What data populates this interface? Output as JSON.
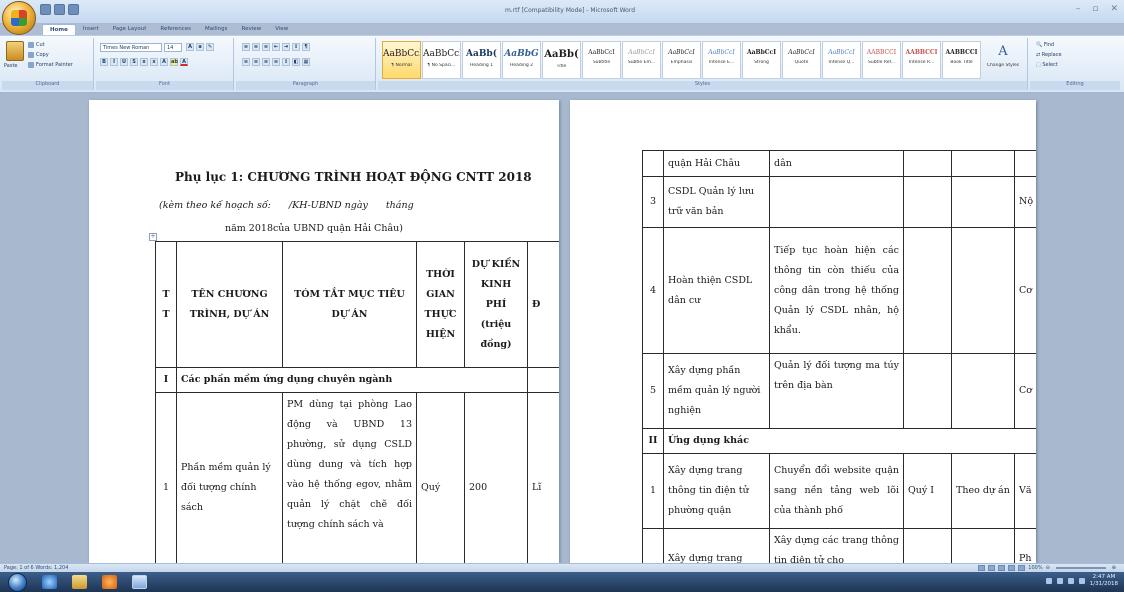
{
  "window": {
    "title": "m.rtf [Compatibility Mode] - Microsoft Word",
    "controls": [
      "–",
      "▫",
      "✕"
    ]
  },
  "tabs": [
    "Home",
    "Insert",
    "Page Layout",
    "References",
    "Mailings",
    "Review",
    "View"
  ],
  "ribbon": {
    "clipboard": {
      "paste": "Paste",
      "cut": "Cut",
      "copy": "Copy",
      "format_painter": "Format Painter",
      "label": "Clipboard"
    },
    "font": {
      "family": "Times New Roman",
      "size": "14",
      "label": "Font"
    },
    "paragraph": {
      "label": "Paragraph"
    },
    "styles": {
      "label": "Styles",
      "change_styles": "Change Styles",
      "items": [
        {
          "sample": "AaBbCcI",
          "name": "¶ Normal"
        },
        {
          "sample": "AaBbCcI",
          "name": "¶ No Spaci..."
        },
        {
          "sample": "AaBb(",
          "name": "Heading 1"
        },
        {
          "sample": "AaBbG",
          "name": "Heading 2"
        },
        {
          "sample": "AaBb(",
          "name": "Title"
        },
        {
          "sample": "AaBbCcI",
          "name": "Subtitle"
        },
        {
          "sample": "AaBbCcI",
          "name": "Subtle Em..."
        },
        {
          "sample": "AaBbCcI",
          "name": "Emphasis"
        },
        {
          "sample": "AaBbCcI",
          "name": "Intense E..."
        },
        {
          "sample": "AaBbCcI",
          "name": "Strong"
        },
        {
          "sample": "AaBbCcI",
          "name": "Quote"
        },
        {
          "sample": "AaBbCcI",
          "name": "Intense Q..."
        },
        {
          "sample": "AABBCCI",
          "name": "Subtle Ref..."
        },
        {
          "sample": "AABBCCI",
          "name": "Intense R..."
        },
        {
          "sample": "AABBCCI",
          "name": "Book Title"
        }
      ]
    },
    "editing": {
      "find": "Find",
      "replace": "Replace",
      "select": "Select",
      "label": "Editing"
    }
  },
  "page1": {
    "title": "Phụ lục 1: CHƯƠNG TRÌNH HOẠT ĐỘNG CNTT 2018",
    "sub1_a": "(kèm theo kế hoạch số:",
    "sub1_b": "/KH-UBND ngày",
    "sub1_c": "tháng",
    "sub2": "năm 2018của UBND quận Hải Châu)",
    "header": {
      "tt": "T T",
      "name": "TÊN CHƯƠNG TRÌNH, DỰ ÁN",
      "goal": "TÓM TẮT MỤC TIÊU DỰ ÁN",
      "time": "THỜI GIAN THỰC HIỆN",
      "cost": "DỰ KIẾN KINH PHÍ (triệu đồng)",
      "next": "Đ"
    },
    "section": {
      "num": "I",
      "label": "Các phần mềm ứng dụng chuyên ngành"
    },
    "row1": {
      "num": "1",
      "name": "Phần mềm quản lý đối tượng chính sách",
      "goal": "PM dùng tại phòng Lao động và UBND 13 phường, sử dụng CSLD dùng dung và tích hợp vào hệ thống egov, nhằm quản lý chặt chẽ đối tượng chính sách và",
      "time": "Quý",
      "cost": "200",
      "next": "Lĩ"
    }
  },
  "page2": {
    "rows": [
      {
        "num": "",
        "name": "quận Hải Châu",
        "goal": "dân",
        "time": "",
        "unit": "",
        "next": ""
      },
      {
        "num": "3",
        "name": "CSDL Quản lý lưu trữ văn bản",
        "goal": "",
        "time": "",
        "unit": "",
        "next": "Nộ"
      },
      {
        "num": "4",
        "name": "Hoàn thiện CSDL dân cư",
        "goal": "Tiếp tục hoàn hiện các thông tin còn thiếu của công dân trong hệ thống Quản lý CSDL nhân, hộ khẩu.",
        "time": "",
        "unit": "",
        "next": "Cơ"
      },
      {
        "num": "5",
        "name": "Xây dựng phần mềm quản lý người nghiện",
        "goal": "Quản lý đối tượng ma túy trên địa bàn",
        "time": "",
        "unit": "",
        "next": "Cơ"
      }
    ],
    "section": {
      "num": "II",
      "label": "Ứng dụng khác"
    },
    "row_w": {
      "num": "1",
      "name": "Xây dựng trang thông tin điện tử phường quận",
      "goal": "Chuyển đổi website quận sang nền tảng web lõi của thành phố",
      "time": "Quý I",
      "unit": "Theo dự án",
      "next": "Vă"
    },
    "row_last": {
      "num": "",
      "name": "Xây dựng trang",
      "goal": "Xây dựng các trang thông tin điện tử cho",
      "time": "",
      "unit": "",
      "next": "Ph"
    }
  },
  "status": {
    "left": "Page: 1 of 6   Words: 1,204",
    "zoom": "100%"
  },
  "taskbar": {
    "time": "2:47 AM",
    "date": "1/31/2018"
  }
}
